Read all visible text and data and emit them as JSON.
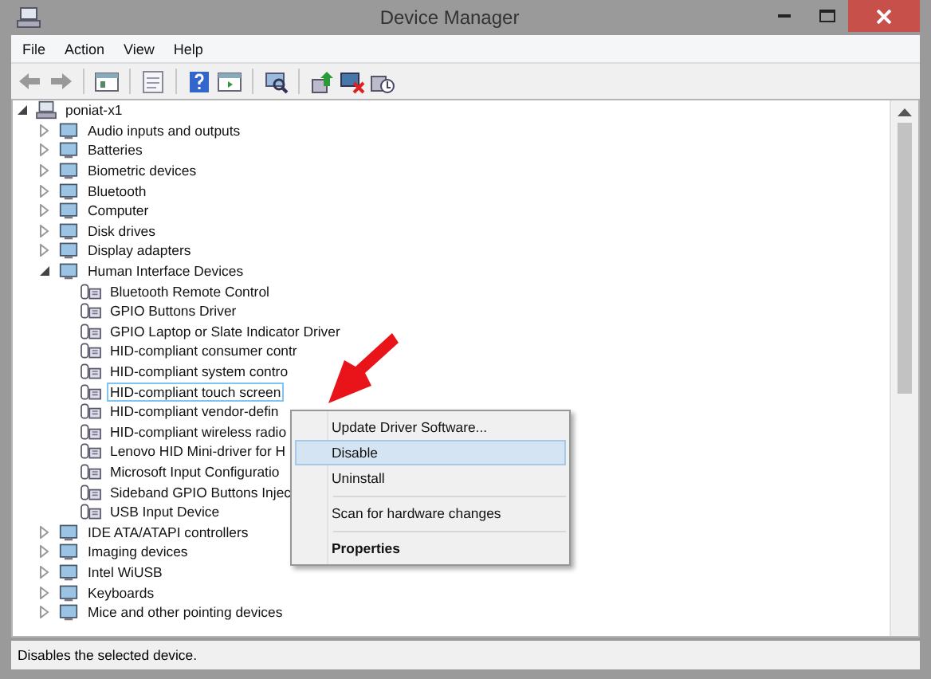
{
  "window": {
    "title": "Device Manager"
  },
  "menu": [
    "File",
    "Action",
    "View",
    "Help"
  ],
  "tree": [
    {
      "label": "poniat-x1",
      "expanded": true,
      "selected": false,
      "children": [
        {
          "label": "Audio inputs and outputs",
          "expanded": false,
          "selected": false
        },
        {
          "label": "Batteries",
          "expanded": false,
          "selected": false
        },
        {
          "label": "Biometric devices",
          "expanded": false,
          "selected": false
        },
        {
          "label": "Bluetooth",
          "expanded": false,
          "selected": false
        },
        {
          "label": "Computer",
          "expanded": false,
          "selected": false
        },
        {
          "label": "Disk drives",
          "expanded": false,
          "selected": false
        },
        {
          "label": "Display adapters",
          "expanded": false,
          "selected": false
        },
        {
          "label": "Human Interface Devices",
          "expanded": true,
          "selected": false,
          "children": [
            {
              "label": "Bluetooth Remote Control",
              "selected": false
            },
            {
              "label": "GPIO Buttons Driver",
              "selected": false
            },
            {
              "label": "GPIO Laptop or Slate Indicator Driver",
              "selected": false
            },
            {
              "label": "HID-compliant consumer contr",
              "selected": false
            },
            {
              "label": "HID-compliant system contro",
              "selected": false
            },
            {
              "label": "HID-compliant touch screen",
              "selected": true
            },
            {
              "label": "HID-compliant vendor-defin",
              "selected": false
            },
            {
              "label": "HID-compliant wireless radio",
              "selected": false
            },
            {
              "label": "Lenovo HID Mini-driver for H",
              "selected": false
            },
            {
              "label": "Microsoft Input Configuratio",
              "selected": false
            },
            {
              "label": "Sideband GPIO Buttons Injec",
              "selected": false
            },
            {
              "label": "USB Input Device",
              "selected": false
            }
          ]
        },
        {
          "label": "IDE ATA/ATAPI controllers",
          "expanded": false,
          "selected": false
        },
        {
          "label": "Imaging devices",
          "expanded": false,
          "selected": false
        },
        {
          "label": "Intel WiUSB",
          "expanded": false,
          "selected": false
        },
        {
          "label": "Keyboards",
          "expanded": false,
          "selected": false
        },
        {
          "label": "Mice and other pointing devices",
          "expanded": false,
          "selected": false
        }
      ]
    }
  ],
  "context_menu": [
    {
      "kind": "item",
      "label": "Update Driver Software...",
      "selected": false,
      "default": false
    },
    {
      "kind": "item",
      "label": "Disable",
      "selected": true,
      "default": false
    },
    {
      "kind": "item",
      "label": "Uninstall",
      "selected": false,
      "default": false
    },
    {
      "kind": "separator"
    },
    {
      "kind": "item",
      "label": "Scan for hardware changes",
      "selected": false,
      "default": false
    },
    {
      "kind": "separator"
    },
    {
      "kind": "item",
      "label": "Properties",
      "selected": false,
      "default": true
    }
  ],
  "status_bar": "Disables the selected device."
}
